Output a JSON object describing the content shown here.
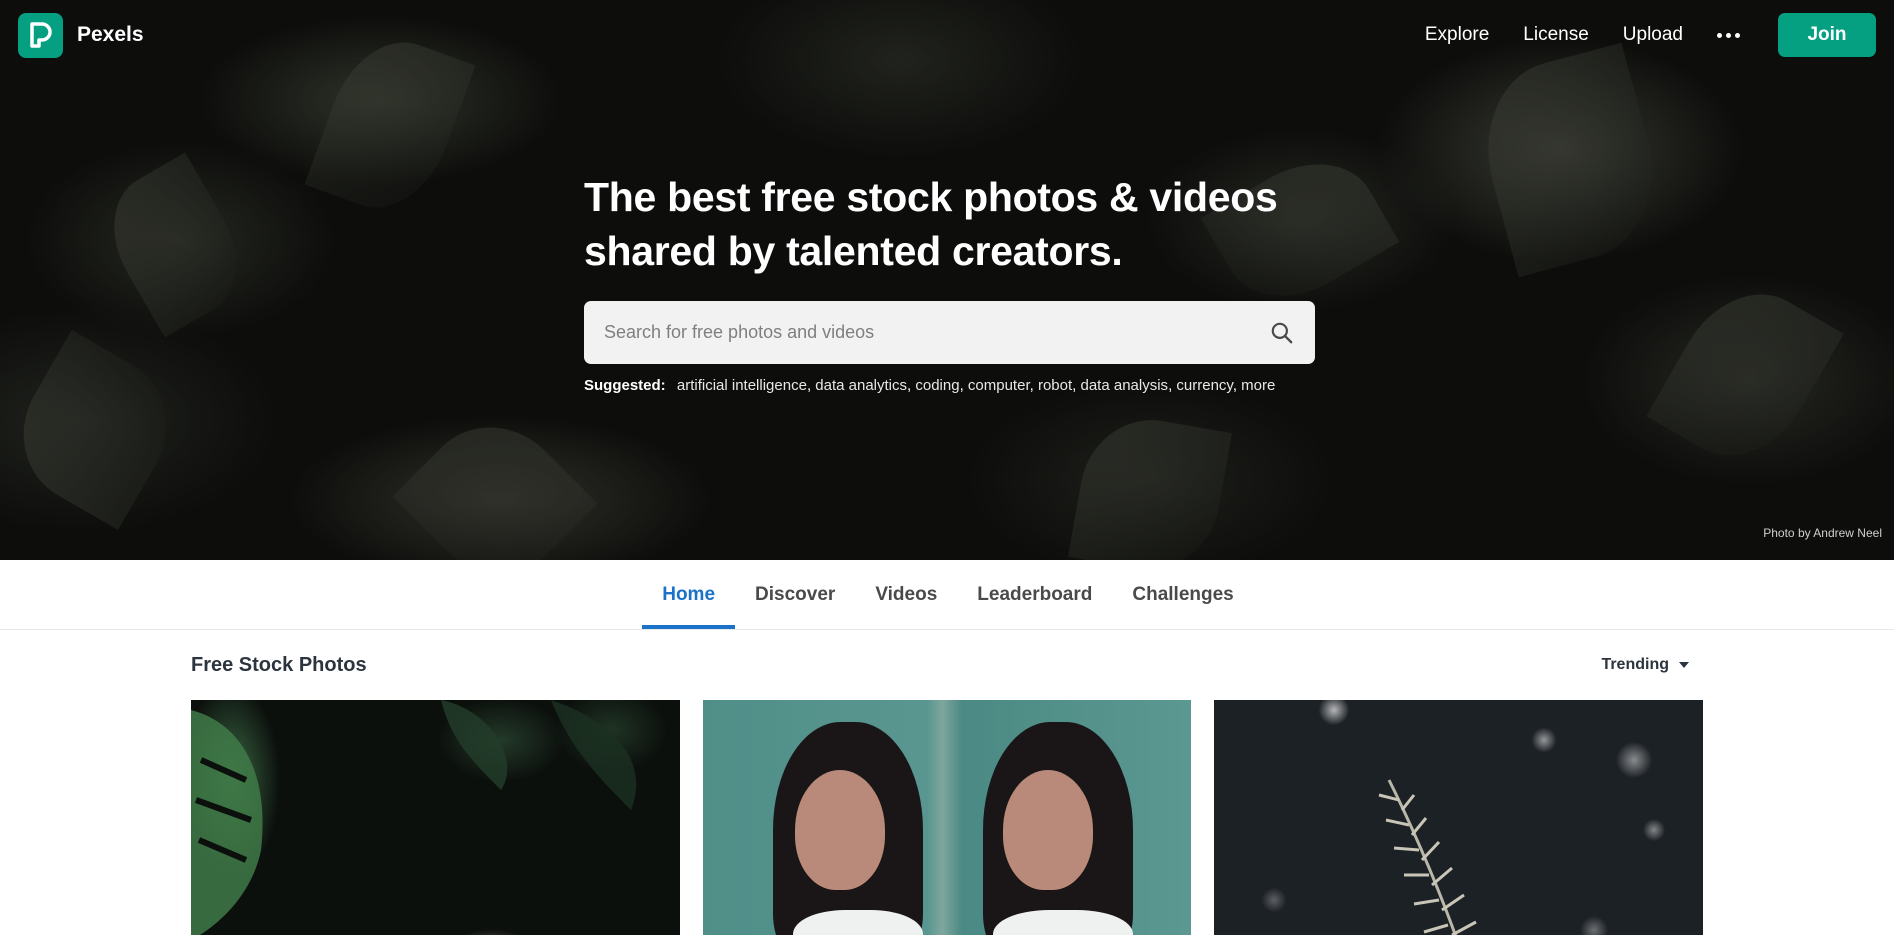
{
  "brand": {
    "name": "Pexels"
  },
  "nav": {
    "links": [
      "Explore",
      "License",
      "Upload"
    ],
    "more_icon": "ellipsis-icon",
    "join_label": "Join"
  },
  "hero": {
    "title_line1": "The best free stock photos & videos",
    "title_line2": "shared by talented creators.",
    "search": {
      "placeholder": "Search for free photos and videos",
      "value": ""
    },
    "suggested_label": "Suggested:",
    "suggested": [
      "artificial intelligence",
      "data analytics",
      "coding",
      "computer",
      "robot",
      "data analysis",
      "currency",
      "more"
    ],
    "photo_credit": "Photo by Andrew Neel"
  },
  "tabs": [
    {
      "label": "Home",
      "active": true
    },
    {
      "label": "Discover",
      "active": false
    },
    {
      "label": "Videos",
      "active": false
    },
    {
      "label": "Leaderboard",
      "active": false
    },
    {
      "label": "Challenges",
      "active": false
    }
  ],
  "gallery": {
    "title": "Free Stock Photos",
    "sort_label": "Trending"
  },
  "colors": {
    "brand": "#05a081",
    "tab_active": "#1a73c8"
  }
}
